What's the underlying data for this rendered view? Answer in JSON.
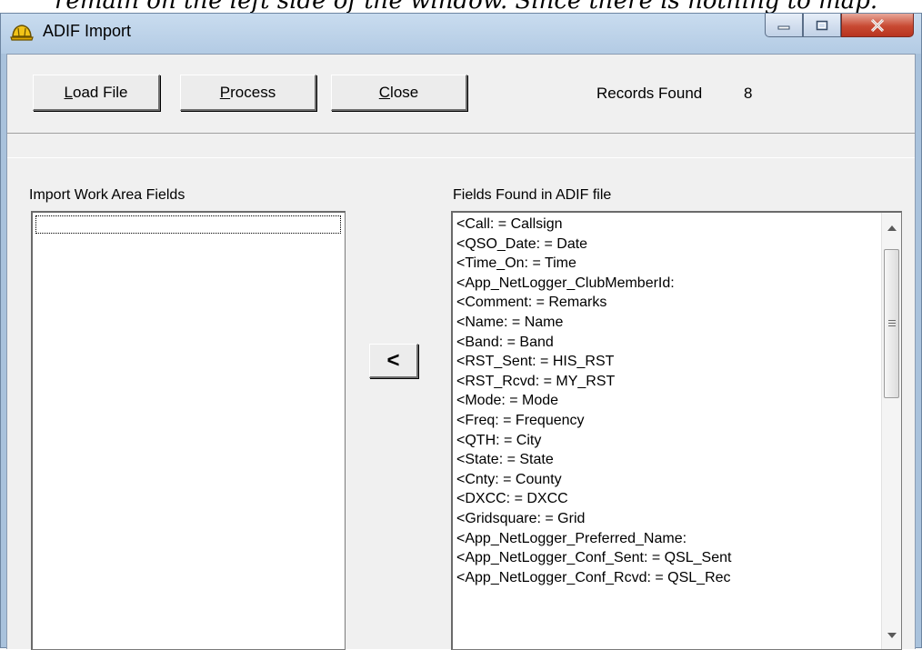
{
  "caption": "remain on the left side of the window. Since there is nothing to map.",
  "window": {
    "title": "ADIF Import",
    "icons": {
      "app": "hardhat-icon",
      "minimize": "minimize-icon",
      "maximize": "maximize-icon",
      "close": "close-icon"
    },
    "close_color": "#c84a33"
  },
  "toolbar": {
    "load_mnemonic": "L",
    "load_rest": "oad File",
    "process_mnemonic": "P",
    "process_rest": "rocess",
    "close_mnemonic": "C",
    "close_rest": "lose",
    "records_label": "Records Found",
    "records_count": "8"
  },
  "left_panel": {
    "label": "Import Work Area Fields",
    "items": []
  },
  "move_button": {
    "label": "<"
  },
  "right_panel": {
    "label": "Fields Found in ADIF file",
    "items": [
      "<Call: = Callsign",
      "<QSO_Date: = Date",
      "<Time_On: = Time",
      "<App_NetLogger_ClubMemberId:",
      "<Comment: = Remarks",
      "<Name: = Name",
      "<Band: = Band",
      "<RST_Sent: = HIS_RST",
      "<RST_Rcvd: = MY_RST",
      "<Mode: = Mode",
      "<Freq: = Frequency",
      "<QTH: = City",
      "<State: = State",
      "<Cnty: = County",
      "<DXCC: = DXCC",
      "<Gridsquare: = Grid",
      "<App_NetLogger_Preferred_Name:",
      "<App_NetLogger_Conf_Sent: = QSL_Sent",
      "<App_NetLogger_Conf_Rcvd: = QSL_Rec"
    ],
    "scroll": {
      "up_icon": "scroll-up-arrow-icon",
      "down_icon": "scroll-down-arrow-icon"
    }
  }
}
